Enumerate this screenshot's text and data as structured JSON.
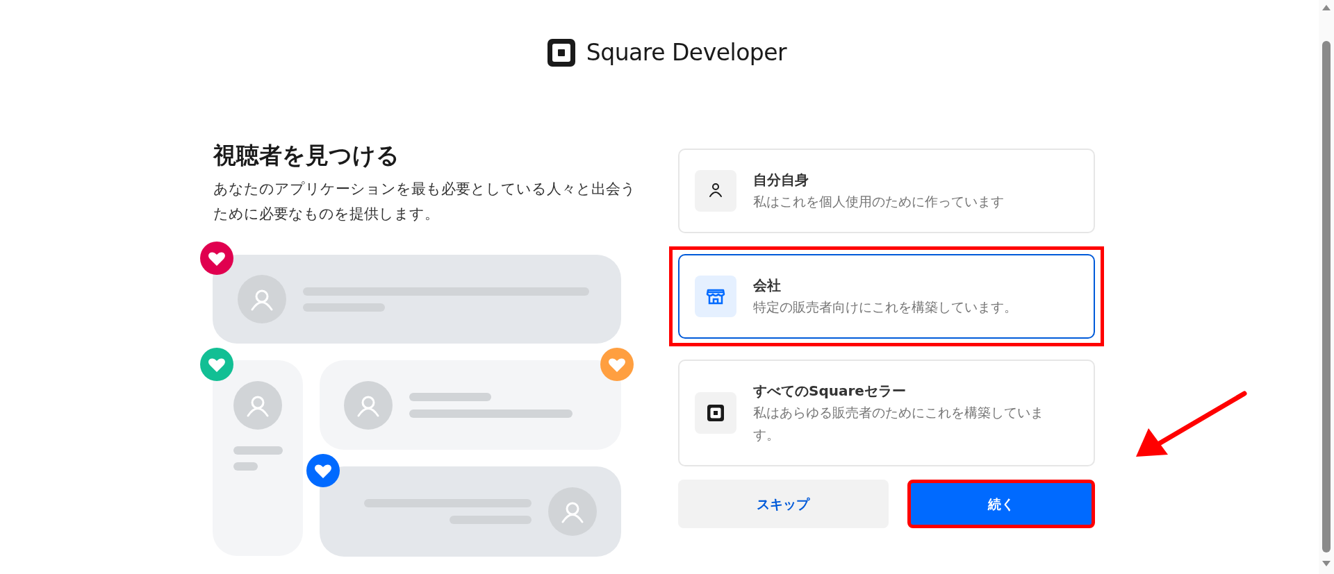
{
  "header": {
    "logo_text": "Square Developer"
  },
  "intro": {
    "title": "視聴者を見つける",
    "description": "あなたのアプリケーションを最も必要としている人々と出会うために必要なものを提供します。"
  },
  "illustration": {
    "hearts": [
      {
        "color": "#e0004f"
      },
      {
        "color": "#12bf94"
      },
      {
        "color": "#ff9f40"
      },
      {
        "color": "#006aff"
      }
    ]
  },
  "options": [
    {
      "kind": "person",
      "title": "自分自身",
      "description": "私はこれを個人使用のために作っています",
      "selected": false,
      "highlighted": false
    },
    {
      "kind": "store",
      "title": "会社",
      "description": "特定の販売者向けにこれを構築しています。",
      "selected": true,
      "highlighted": true
    },
    {
      "kind": "square",
      "title": "すべてのSquareセラー",
      "description": "私はあらゆる販売者のためにこれを構築しています。",
      "selected": false,
      "highlighted": false
    }
  ],
  "buttons": [
    {
      "kind": "secondary",
      "label": "スキップ",
      "highlighted": false
    },
    {
      "kind": "primary",
      "label": "続く",
      "highlighted": true
    }
  ],
  "pointer_arrow": true
}
